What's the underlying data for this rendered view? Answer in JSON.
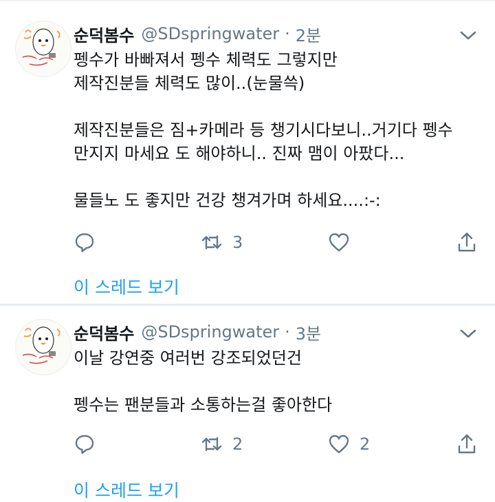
{
  "tweets": [
    {
      "display_name": "순덕봄수",
      "handle": "@SDspringwater",
      "separator": "·",
      "time": "2분",
      "text": "펭수가 바빠져서 펭수 체력도 그렇지만\n제작진분들 체력도 많이..(눈물쓱)\n\n제작진분들은 짐+카메라 등 챙기시다보니..거기다 펭수\n만지지 마세요 도 해야하니.. 진짜 맴이 아팠다...\n\n물들노 도 좋지만 건강 챙겨가며 하세요....:-:",
      "reply_count": "",
      "retweet_count": "3",
      "like_count": "",
      "thread_link": "이 스레드 보기",
      "avatar_icon": "penguin-doodle-avatar"
    },
    {
      "display_name": "순덕봄수",
      "handle": "@SDspringwater",
      "separator": "·",
      "time": "3분",
      "text": "이날 강연중 여러번 강조되었던건\n\n펭수는 팬분들과 소통하는걸 좋아한다",
      "reply_count": "",
      "retweet_count": "2",
      "like_count": "2",
      "thread_link": "이 스레드 보기",
      "avatar_icon": "penguin-doodle-avatar"
    }
  ],
  "colors": {
    "accent": "#1da1f2",
    "secondary_text": "#657786",
    "primary_text": "#14171a",
    "divider": "#e6ecf0"
  },
  "icons": [
    "reply-icon",
    "retweet-icon",
    "like-icon",
    "share-icon",
    "chevron-down-icon"
  ]
}
